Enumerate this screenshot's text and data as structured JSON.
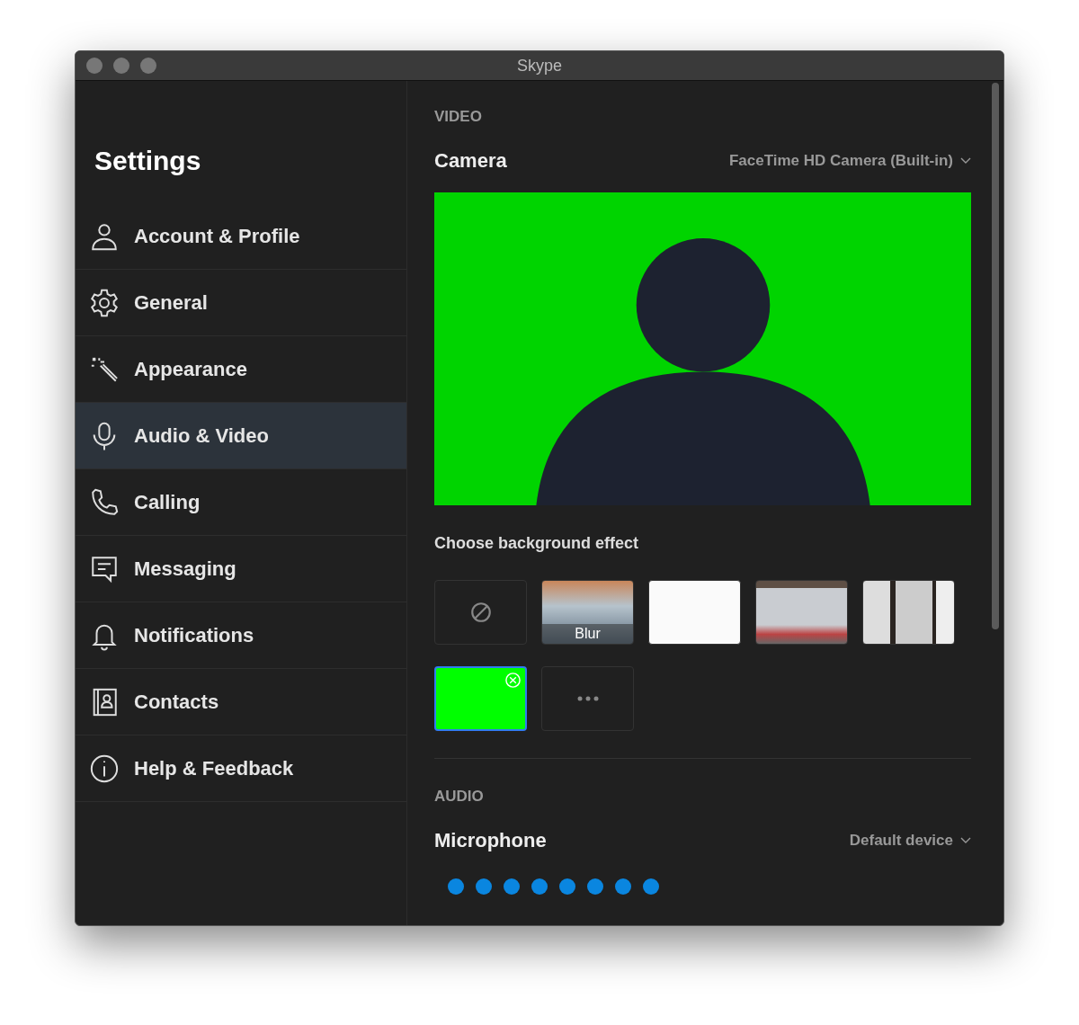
{
  "window": {
    "title": "Skype"
  },
  "sidebar": {
    "title": "Settings",
    "items": [
      {
        "label": "Account & Profile",
        "selected": false
      },
      {
        "label": "General",
        "selected": false
      },
      {
        "label": "Appearance",
        "selected": false
      },
      {
        "label": "Audio & Video",
        "selected": true
      },
      {
        "label": "Calling",
        "selected": false
      },
      {
        "label": "Messaging",
        "selected": false
      },
      {
        "label": "Notifications",
        "selected": false
      },
      {
        "label": "Contacts",
        "selected": false
      },
      {
        "label": "Help & Feedback",
        "selected": false
      }
    ]
  },
  "video": {
    "heading": "VIDEO",
    "camera_label": "Camera",
    "camera_device": "FaceTime HD Camera (Built-in)",
    "effects_label": "Choose background effect",
    "effects": [
      {
        "kind": "none",
        "selected": false
      },
      {
        "kind": "blur",
        "label": "Blur",
        "selected": false
      },
      {
        "kind": "image",
        "selected": false
      },
      {
        "kind": "image",
        "selected": false
      },
      {
        "kind": "image",
        "selected": false
      },
      {
        "kind": "solid",
        "selected": true
      },
      {
        "kind": "more",
        "selected": false
      }
    ]
  },
  "audio": {
    "heading": "AUDIO",
    "microphone_label": "Microphone",
    "microphone_device": "Default device"
  }
}
